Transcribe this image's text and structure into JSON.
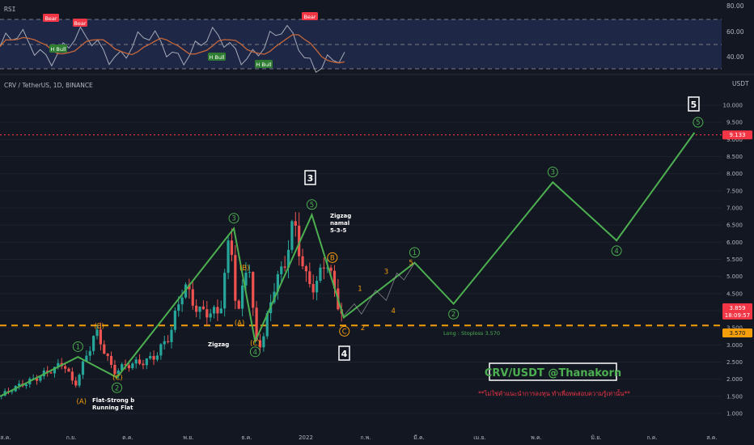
{
  "rsi_panel": {
    "title": "RSI",
    "levels": [
      80.0,
      60.0,
      40.0
    ],
    "level_labels": [
      "80.00",
      "60.00",
      "40.00"
    ],
    "tags": [
      {
        "text": "Bear",
        "kind": "bear"
      },
      {
        "text": "Bear",
        "kind": "bear"
      },
      {
        "text": "Bear",
        "kind": "bear"
      },
      {
        "text": "H Bull",
        "kind": "bull"
      },
      {
        "text": "H Bull",
        "kind": "bull"
      },
      {
        "text": "H Bull",
        "kind": "bull"
      }
    ]
  },
  "symbol_header": "CRV / TetherUS, 1D, BINANCE",
  "axis_unit": "USDT",
  "price_badges": {
    "target": "9.133",
    "current": "3.859",
    "countdown": "18:09:57",
    "stop": "3.570"
  },
  "stoploss_label": "Long : Stoploss 3.570",
  "wave_boxes": [
    "3",
    "4",
    "5"
  ],
  "notes": {
    "zigzag": "Zigzag",
    "zigzag_normal_1": "Zigzag",
    "zigzag_normal_2": "namal",
    "zigzag_normal_3": "5-3-5",
    "flat_1": "Flat-Strong b",
    "flat_2": "Running Flat"
  },
  "watermark": "CRV/USDT @Thanakorn",
  "disclaimer": "**ไม่ใช่คำแนะนำการลงทุน ทำเพื่อทดสอบความรู้เท่านั้น**",
  "colors": {
    "background": "#131722",
    "bull_candle": "#26a69a",
    "bear_candle": "#ef5350",
    "wave_line": "#4caf50",
    "orange": "#f59e0b",
    "rsi_band": "#2a3566",
    "target_line": "#f23645",
    "rsi_line": "#787b86",
    "rsi_ma": "#c5673a"
  },
  "chart_data": {
    "type": "candlestick",
    "title": "CRV / TetherUS, 1D, BINANCE",
    "y_axis": {
      "unit": "USDT",
      "ticks": [
        1.0,
        1.5,
        2.0,
        2.5,
        3.0,
        3.5,
        4.0,
        4.5,
        5.0,
        5.5,
        6.0,
        6.5,
        7.0,
        7.5,
        8.0,
        8.5,
        9.0,
        9.5,
        10.0
      ],
      "tick_labels": [
        "1.000",
        "1.500",
        "2.000",
        "2.500",
        "3.000",
        "3.500",
        "4.000",
        "4.500",
        "5.000",
        "5.500",
        "6.000",
        "6.500",
        "7.000",
        "7.500",
        "8.000",
        "8.500",
        "9.000",
        "9.500",
        "10.000"
      ],
      "range": [
        0.8,
        11.2
      ]
    },
    "x_axis": {
      "tick_labels": [
        "ส.ค.",
        "ก.ย.",
        "ต.ค.",
        "พ.ย.",
        "ธ.ค.",
        "2022",
        "ก.พ.",
        "มี.ค.",
        "เม.ย.",
        "พ.ค.",
        "มิ.ย.",
        "ก.ค.",
        "ส.ค."
      ],
      "range": [
        0,
        100
      ]
    },
    "price_series": [
      {
        "x": 0,
        "y": 1.5
      },
      {
        "x": 3,
        "y": 1.8
      },
      {
        "x": 6,
        "y": 2.2
      },
      {
        "x": 9,
        "y": 2.4
      },
      {
        "x": 10.5,
        "y": 1.75
      },
      {
        "x": 13.5,
        "y": 3.5
      },
      {
        "x": 16,
        "y": 2.15
      },
      {
        "x": 19,
        "y": 2.5
      },
      {
        "x": 22,
        "y": 2.7
      },
      {
        "x": 24,
        "y": 3.2
      },
      {
        "x": 26,
        "y": 4.8
      },
      {
        "x": 28,
        "y": 4.1
      },
      {
        "x": 31,
        "y": 3.8
      },
      {
        "x": 32.5,
        "y": 6.2
      },
      {
        "x": 33.5,
        "y": 3.7
      },
      {
        "x": 35,
        "y": 5.9
      },
      {
        "x": 36,
        "y": 3.2
      },
      {
        "x": 37,
        "y": 3.0
      },
      {
        "x": 38.5,
        "y": 4.5
      },
      {
        "x": 40,
        "y": 5.2
      },
      {
        "x": 41.5,
        "y": 6.8
      },
      {
        "x": 43,
        "y": 5.1
      },
      {
        "x": 44.5,
        "y": 4.6
      },
      {
        "x": 46,
        "y": 5.4
      },
      {
        "x": 47.5,
        "y": 4.3
      },
      {
        "x": 48.5,
        "y": 3.86
      }
    ],
    "wave_path": {
      "name": "Elliott wave count",
      "points": [
        {
          "x": 0,
          "y": 1.5
        },
        {
          "x": 11,
          "y": 2.65
        },
        {
          "x": 16.5,
          "y": 2.05
        },
        {
          "x": 33,
          "y": 6.4
        },
        {
          "x": 36,
          "y": 3.1
        },
        {
          "x": 44,
          "y": 6.8
        },
        {
          "x": 48.5,
          "y": 3.8
        },
        {
          "x": 58.5,
          "y": 5.4
        },
        {
          "x": 64,
          "y": 4.2
        },
        {
          "x": 78,
          "y": 7.75
        },
        {
          "x": 87,
          "y": 6.05
        },
        {
          "x": 98,
          "y": 9.2
        }
      ]
    },
    "horizontal_lines": [
      {
        "y": 9.133,
        "style": "dotted",
        "color": "#f23645"
      },
      {
        "y": 3.57,
        "style": "dashed",
        "color": "#f59e0b"
      }
    ],
    "wave_labels": [
      {
        "text": "1",
        "x": 11,
        "y": 2.95,
        "color": "green",
        "circle": true
      },
      {
        "text": "3",
        "x": 33,
        "y": 6.7,
        "color": "green",
        "circle": true
      },
      {
        "text": "5",
        "x": 44,
        "y": 7.1,
        "color": "green",
        "circle": true
      },
      {
        "text": "1",
        "x": 58.5,
        "y": 5.7,
        "color": "green",
        "circle": true
      },
      {
        "text": "2",
        "x": 64,
        "y": 3.9,
        "color": "green",
        "circle": true
      },
      {
        "text": "3",
        "x": 78,
        "y": 8.05,
        "color": "green",
        "circle": true
      },
      {
        "text": "4",
        "x": 87,
        "y": 5.75,
        "color": "green",
        "circle": true
      },
      {
        "text": "5",
        "x": 98.5,
        "y": 9.5,
        "color": "green",
        "circle": true
      },
      {
        "text": "2",
        "x": 16.5,
        "y": 1.75,
        "color": "green",
        "circle": true
      },
      {
        "text": "4",
        "x": 36,
        "y": 2.8,
        "color": "green",
        "circle": true
      },
      {
        "text": "(B)",
        "x": 14,
        "y": 3.55,
        "color": "orange",
        "circle": false
      },
      {
        "text": "(C)",
        "x": 16.6,
        "y": 2.05,
        "color": "orange",
        "circle": false
      },
      {
        "text": "(A)",
        "x": 11.5,
        "y": 1.35,
        "color": "orange",
        "circle": false
      },
      {
        "text": "(B)",
        "x": 34.5,
        "y": 5.25,
        "color": "orange",
        "circle": false
      },
      {
        "text": "(A)",
        "x": 33.8,
        "y": 3.65,
        "color": "orange",
        "circle": false
      },
      {
        "text": "(C)",
        "x": 36,
        "y": 3.05,
        "color": "orange",
        "circle": false
      },
      {
        "text": "B",
        "x": 46.9,
        "y": 5.55,
        "color": "orange",
        "circle": true
      },
      {
        "text": "C",
        "x": 48.6,
        "y": 3.4,
        "color": "orange",
        "circle": true
      },
      {
        "text": "2",
        "x": 51.2,
        "y": 3.5,
        "color": "orange",
        "circle": false
      },
      {
        "text": "1",
        "x": 50.8,
        "y": 4.65,
        "color": "orange",
        "circle": false
      },
      {
        "text": "3",
        "x": 54.5,
        "y": 5.15,
        "color": "orange",
        "circle": false
      },
      {
        "text": "4",
        "x": 55.5,
        "y": 4.0,
        "color": "orange",
        "circle": false
      },
      {
        "text": "5",
        "x": 58,
        "y": 5.4,
        "color": "orange",
        "circle": false
      }
    ]
  }
}
